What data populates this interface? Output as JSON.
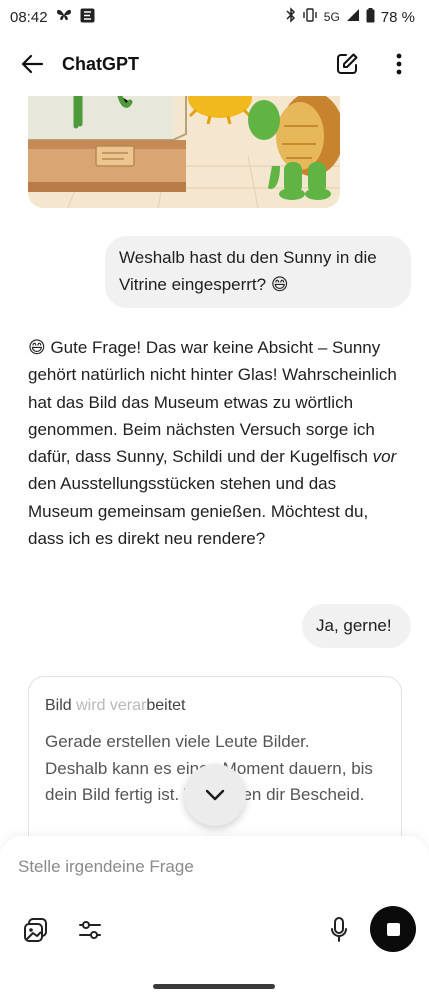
{
  "status_bar": {
    "time": "08:42",
    "network": "5G",
    "battery": "78 %"
  },
  "header": {
    "title": "ChatGPT"
  },
  "messages": {
    "user_1": "Weshalb hast du den Sunny in die Vitrine eingesperrt? 😄",
    "assistant_1": {
      "part1": "😄 Gute Frage! Das war keine Absicht – Sunny gehört natürlich nicht hinter Glas! Wahrscheinlich hat das Bild das Museum etwas zu wörtlich genommen. Beim nächsten Versuch sorge ich dafür, dass Sunny, Schildi und der Kugelfisch ",
      "emph": "vor",
      "part2": " den Ausstellungsstücken stehen und das Museum gemeinsam genießen. Möchtest du, dass ich es direkt neu rendere?"
    },
    "user_2": "Ja, gerne!"
  },
  "processing_card": {
    "title_part1": "Bild ",
    "title_faded": "wird verar",
    "title_part2": "beitet",
    "body": "Gerade erstellen viele Leute Bilder. Deshalb kann es einen Moment dauern, bis dein Bild fertig ist. Wir geben dir Bescheid."
  },
  "composer": {
    "placeholder": "Stelle irgendeine Frage"
  },
  "icons": {
    "status_left": [
      "butterfly-icon",
      "app-icon"
    ],
    "status_right": [
      "bluetooth-icon",
      "vibrate-icon",
      "signal-icon",
      "battery-icon"
    ],
    "header": [
      "back-arrow-icon",
      "edit-icon",
      "more-vert-icon"
    ],
    "composer": [
      "image-icon",
      "sliders-icon",
      "mic-icon",
      "stop-icon"
    ],
    "scroll": "chevron-down-icon"
  },
  "colors": {
    "bubble": "#f1f1f1",
    "stop_button": "#0b0b0b",
    "placeholder": "#8a8a8a"
  }
}
